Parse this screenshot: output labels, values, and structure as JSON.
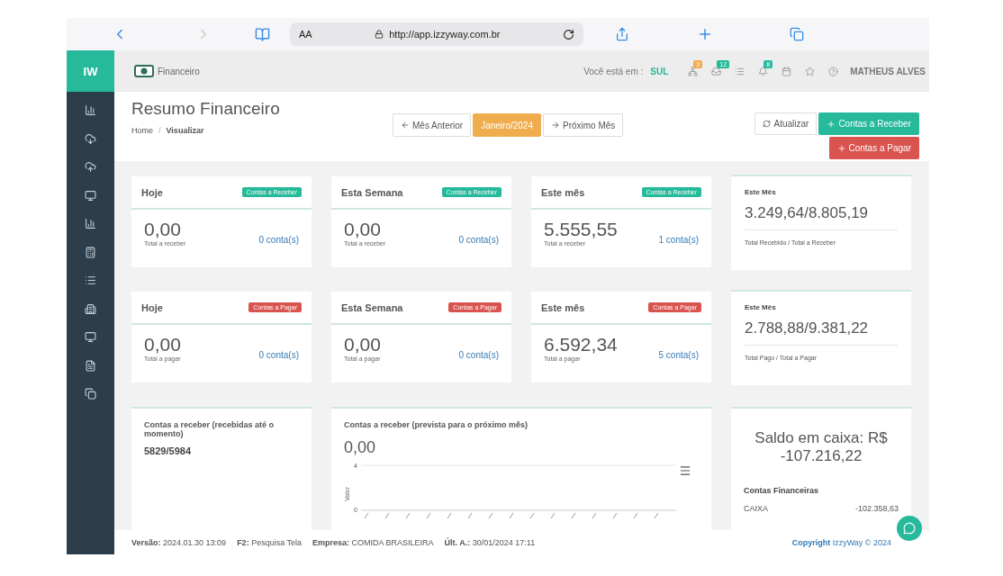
{
  "browser": {
    "text_size": "AA",
    "url": "http://app.izzyway.com.br"
  },
  "app": {
    "logo": "IW",
    "module": "Financeiro",
    "location_label": "Você está em :",
    "location": "SUL",
    "user": "MATHEUS ALVES",
    "header_icons": [
      {
        "kind": "sitemap",
        "badge": "3",
        "color": "#f0ad4e"
      },
      {
        "kind": "inbox",
        "badge": "12",
        "color": "#26b99a"
      },
      {
        "kind": "list"
      },
      {
        "kind": "bell",
        "badge": "8",
        "color": "#26b99a"
      },
      {
        "kind": "calendar"
      },
      {
        "kind": "star"
      },
      {
        "kind": "help"
      }
    ]
  },
  "page": {
    "title": "Resumo Financeiro",
    "breadcrumb": [
      "Home",
      "Visualizar"
    ],
    "breadcrumb_separator": "/",
    "month_nav": [
      {
        "label": "Mês Anterior",
        "kind": "prev",
        "selected": false
      },
      {
        "label": "Janeiro/2024",
        "kind": "current",
        "selected": true
      },
      {
        "label": "Próximo Mês",
        "kind": "next",
        "selected": false
      }
    ],
    "actions": [
      {
        "label": "Atualizar",
        "kind": "refresh"
      },
      {
        "label": "Contas a Receber",
        "kind": "receive"
      },
      {
        "label": "Contas a Pagar",
        "kind": "pay"
      }
    ]
  },
  "card_rows": [
    {
      "cards": [
        {
          "title": "Hoje",
          "tag": "Contas a Receber",
          "kind": "receive",
          "value": "0,00",
          "caption": "Total a receber",
          "count": "0 conta(s)"
        },
        {
          "title": "Esta Semana",
          "tag": "Contas a Receber",
          "kind": "receive",
          "value": "0,00",
          "caption": "Total a receber",
          "count": "0 conta(s)"
        },
        {
          "title": "Este mês",
          "tag": "Contas a Receber",
          "kind": "receive",
          "value": "5.555,55",
          "caption": "Total a receber",
          "count": "1 conta(s)"
        }
      ],
      "summary": {
        "title": "Este Mês",
        "value": "3.249,64/8.805,19",
        "caption": "Total Recebido / Total a Receber"
      }
    },
    {
      "cards": [
        {
          "title": "Hoje",
          "tag": "Contas a Pagar",
          "kind": "pay",
          "value": "0,00",
          "caption": "Total a pagar",
          "count": "0 conta(s)"
        },
        {
          "title": "Esta Semana",
          "tag": "Contas a Pagar",
          "kind": "pay",
          "value": "0,00",
          "caption": "Total a pagar",
          "count": "0 conta(s)"
        },
        {
          "title": "Este mês",
          "tag": "Contas a Pagar",
          "kind": "pay",
          "value": "6.592,34",
          "caption": "Total a pagar",
          "count": "5 conta(s)"
        }
      ],
      "summary": {
        "title": "Este Mês",
        "value": "2.788,88/9.381,22",
        "caption": "Total Pago / Total a Pagar"
      }
    }
  ],
  "received": {
    "title": "Contas a receber (recebidas até o momento)",
    "value": "5829/5984"
  },
  "forecast": {
    "title": "Contas a receber (prevista para o próximo mês)",
    "value": "0,00",
    "chart": {
      "ylabel": "Valor",
      "yticks": [
        "4",
        "0"
      ]
    }
  },
  "balance": {
    "title": "Saldo em caixa: R$ -107.216,22",
    "accounts_title": "Contas Financeiras",
    "accounts": [
      {
        "name": "CAIXA",
        "value": "-102.358,63"
      }
    ]
  },
  "footer": {
    "items": [
      {
        "label": "Versão:",
        "value": "2024.01.30 13:09"
      },
      {
        "label": "F2:",
        "value": "Pesquisa Tela"
      },
      {
        "label": "Empresa:",
        "value": "COMIDA BRASILEIRA"
      },
      {
        "label": "Últ. A.:",
        "value": "30/01/2024 17:11"
      }
    ],
    "copyright": "Copyright",
    "brand": "IzzyWay © 2024"
  }
}
